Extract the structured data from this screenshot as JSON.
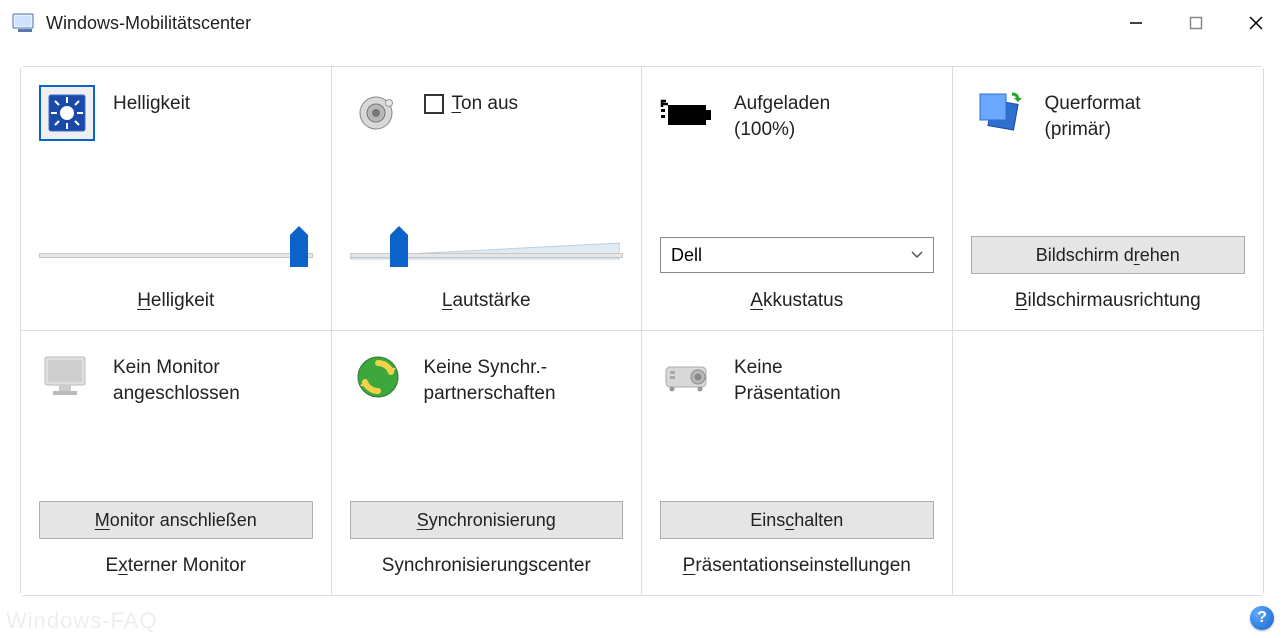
{
  "window": {
    "title": "Windows-Mobilitätscenter"
  },
  "tiles": {
    "brightness": {
      "status": "Helligkeit",
      "caption_pre": "",
      "caption_hot": "H",
      "caption_post": "elligkeit",
      "slider_percent": 95
    },
    "volume": {
      "mute_pre": "",
      "mute_hot": "T",
      "mute_post": "on aus",
      "caption_pre": "",
      "caption_hot": "L",
      "caption_post": "autstärke",
      "slider_percent": 18
    },
    "battery": {
      "status_line1": "Aufgeladen",
      "status_line2": "(100%)",
      "selected": "Dell",
      "caption_pre": "",
      "caption_hot": "A",
      "caption_post": "kkustatus"
    },
    "orientation": {
      "status_line1": "Querformat",
      "status_line2": "(primär)",
      "button_pre": "Bildschirm d",
      "button_hot": "r",
      "button_post": "ehen",
      "caption_pre": "",
      "caption_hot": "B",
      "caption_post": "ildschirmausrichtung"
    },
    "monitor": {
      "status_line1": "Kein Monitor",
      "status_line2": "angeschlossen",
      "button_pre": "",
      "button_hot": "M",
      "button_post": "onitor anschließen",
      "caption_pre": "E",
      "caption_hot": "x",
      "caption_post": "terner Monitor"
    },
    "sync": {
      "status_line1": "Keine Synchr.-",
      "status_line2": "partnerschaften",
      "button_pre": "",
      "button_hot": "S",
      "button_post": "ynchronisierung",
      "caption": "Synchronisierungscenter"
    },
    "presentation": {
      "status_line1": "Keine",
      "status_line2": "Präsentation",
      "button_pre": "Eins",
      "button_hot": "c",
      "button_post": "halten",
      "caption_pre": "",
      "caption_hot": "P",
      "caption_post": "räsentationseinstellungen"
    }
  },
  "watermark": "Windows-FAQ",
  "help_symbol": "?"
}
